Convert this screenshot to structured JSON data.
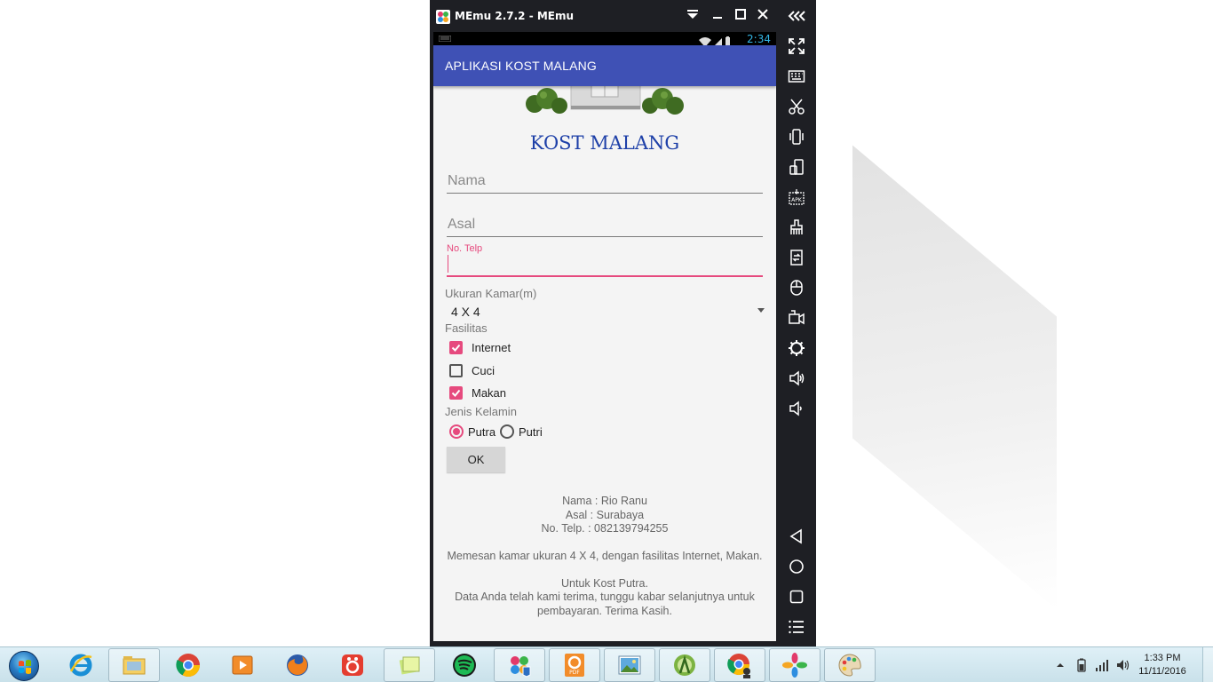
{
  "window": {
    "title": "MEmu 2.7.2 - MEmu"
  },
  "statusbar": {
    "time": "2:34"
  },
  "app": {
    "title": "APLIKASI KOST MALANG",
    "heading": "KOST MALANG"
  },
  "form": {
    "nama_placeholder": "Nama",
    "asal_placeholder": "Asal",
    "telp_label": "No. Telp",
    "telp_value": "",
    "ukuran_label": "Ukuran Kamar(m)",
    "ukuran_value": "4 X 4",
    "fasilitas_label": "Fasilitas",
    "fasilitas": [
      {
        "label": "Internet",
        "checked": true
      },
      {
        "label": "Cuci",
        "checked": false
      },
      {
        "label": "Makan",
        "checked": true
      }
    ],
    "jenis_label": "Jenis Kelamin",
    "jenis_options": [
      {
        "label": "Putra",
        "selected": true
      },
      {
        "label": "Putri",
        "selected": false
      }
    ],
    "ok_label": "OK"
  },
  "result": {
    "nama_line": "Nama :   Rio Ranu",
    "asal_line": "Asal       :   Surabaya",
    "telp_line": "No. Telp.    :   082139794255",
    "message_1": "Memesan kamar ukuran 4 X 4, dengan fasilitas Internet, Makan.",
    "message_2": "Untuk Kost Putra.",
    "message_3": "Data Anda telah kami terima, tunggu kabar selanjutnya untuk pembayaran. Terima Kasih."
  },
  "clock": {
    "time": "1:33 PM",
    "date": "11/11/2016"
  },
  "colors": {
    "appbar": "#3f51b5",
    "accent": "#e64a7e",
    "heading": "#1e40a8",
    "emulator_frame": "#1e1f24"
  }
}
